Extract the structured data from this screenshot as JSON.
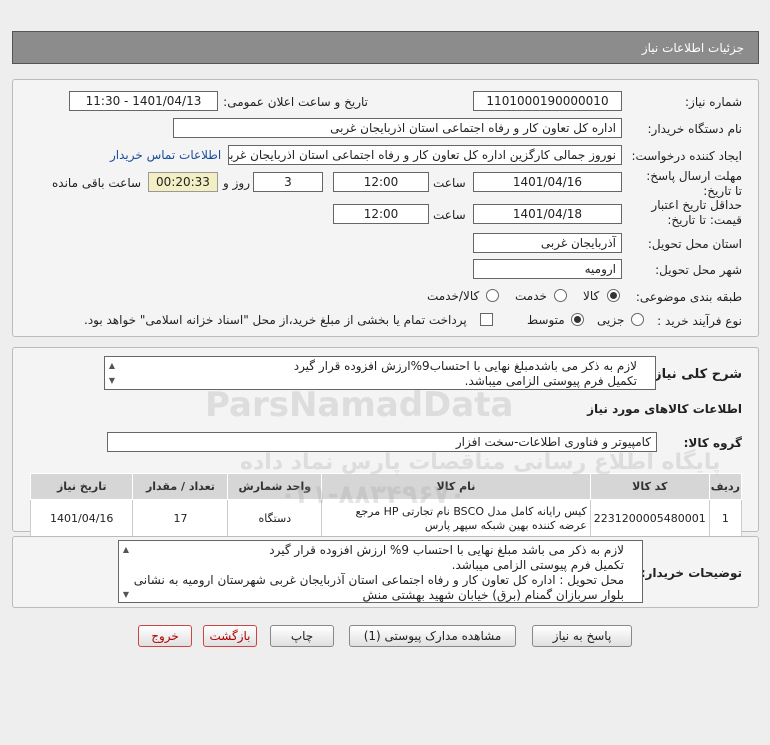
{
  "header": {
    "title": "جزئیات اطلاعات نیاز"
  },
  "form": {
    "need_number_label": "شماره نیاز:",
    "need_number": "1101000190000010",
    "announce_label": "تاریخ و ساعت اعلان عمومی:",
    "announce_value": "1401/04/13 - 11:30",
    "buyer_org_label": "نام دستگاه خریدار:",
    "buyer_org": "اداره کل تعاون  کار و رفاه اجتماعی استان اذربایجان غربی",
    "creator_label": "ایجاد کننده درخواست:",
    "creator": "نوروز جمالی کارگزین اداره کل تعاون  کار و رفاه اجتماعی استان اذربایجان غربی",
    "contact_link": "اطلاعات تماس خریدار",
    "reply_deadline_label": "مهلت ارسال پاسخ: تا تاریخ:",
    "reply_date": "1401/04/16",
    "time_label": "ساعت",
    "reply_time": "12:00",
    "days_value": "3",
    "days_label": "روز و",
    "remaining_value": "00:20:33",
    "remaining_label": "ساعت باقی مانده",
    "validity_label": "حداقل تاریخ اعتبار قیمت: تا تاریخ:",
    "validity_date": "1401/04/18",
    "validity_time": "12:00",
    "province_label": "استان محل تحویل:",
    "province": "آذربایجان غربی",
    "city_label": "شهر محل تحویل:",
    "city": "ارومیه",
    "category_label": "طبقه بندی موضوعی:",
    "cat_goods": "کالا",
    "cat_service": "خدمت",
    "cat_goods_service": "کالا/خدمت",
    "process_label": "نوع فرآیند خرید :",
    "proc_partial": "جزیی",
    "proc_medium": "متوسط",
    "payment_note": "پرداخت تمام یا بخشی از مبلغ خرید،از محل \"اسناد خزانه اسلامی\" خواهد بود."
  },
  "summary": {
    "label": "شرح کلی نیاز:",
    "text_line1": "لازم به ذکر می باشدمبلغ نهایی با احتساب9%ارزش افزوده قرار گیرد",
    "text_line2": "تکمیل فرم پیوستی الزامی میباشد.",
    "goods_info_title": "اطلاعات کالاهای مورد نیاز",
    "group_label": "گروه کالا:",
    "group_value": "کامپیوتر و فناوری اطلاعات-سخت افزار"
  },
  "table": {
    "headers": [
      "ردیف",
      "کد کالا",
      "نام کالا",
      "واحد شمارش",
      "تعداد / مقدار",
      "تاریخ نیاز"
    ],
    "rows": [
      {
        "row": "1",
        "code": "2231200005480001",
        "name": "کیس رایانه کامل مدل BSCO نام تجارتی HP مرجع عرضه کننده بهین شبکه سپهر پارس",
        "unit": "دستگاه",
        "qty": "17",
        "date": "1401/04/16"
      }
    ]
  },
  "buyer_notes": {
    "label": "توضیحات خریدار:",
    "line1": "لازم به ذکر می باشد مبلغ نهایی با احتساب 9% ارزش افزوده قرار گیرد",
    "line2": "تکمیل فرم پیوستی الزامی میباشد.",
    "line3": "محل تحویل : اداره کل تعاون کار و رفاه اجتماعی استان آذربایجان غربی شهرستان ارومیه  به نشانی",
    "line4": "بلوار سربازان گمنام (برق) خیابان شهید بهشتی منش"
  },
  "buttons": {
    "reply": "پاسخ به نیاز",
    "attachments": "مشاهده مدارک پیوستی (1)",
    "print": "چاپ",
    "back": "بازگشت",
    "exit": "خروج"
  },
  "watermark": {
    "brand": "ParsNamadData",
    "tagline": "پایگاه اطلاع رسانی مناقصات پارس نماد داده",
    "phone": "۰۲۱-۸۸۳۴۹۶۷۰"
  }
}
